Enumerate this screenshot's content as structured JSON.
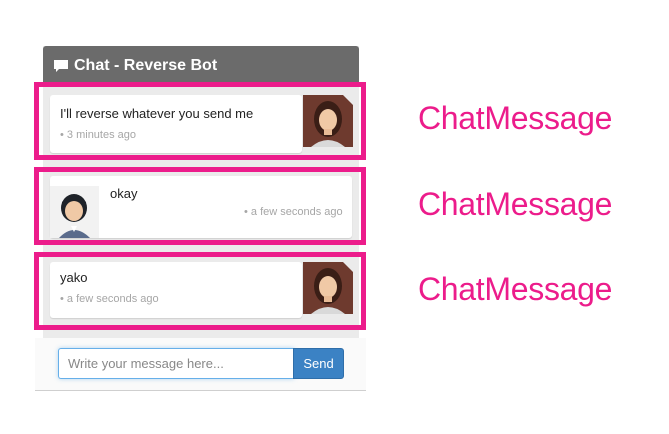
{
  "header": {
    "title": "Chat - Reverse Bot",
    "icon": "chat-bubble-icon"
  },
  "messages": [
    {
      "text": "I'll reverse whatever you send me",
      "time": "• 3 minutes ago",
      "sender": "bot",
      "avatar": "woman-avatar-icon"
    },
    {
      "text": "okay",
      "time": "• a few seconds ago",
      "sender": "user",
      "avatar": "man-avatar-icon"
    },
    {
      "text": "yako",
      "time": "• a few seconds ago",
      "sender": "bot",
      "avatar": "woman-avatar-icon"
    }
  ],
  "annotations": [
    "ChatMessage",
    "ChatMessage",
    "ChatMessage"
  ],
  "composer": {
    "placeholder": "Write your message here...",
    "value": "",
    "send_label": "Send"
  },
  "colors": {
    "highlight": "#ec1c8b",
    "header": "#6b6b6b",
    "send_button": "#3b82c4"
  }
}
